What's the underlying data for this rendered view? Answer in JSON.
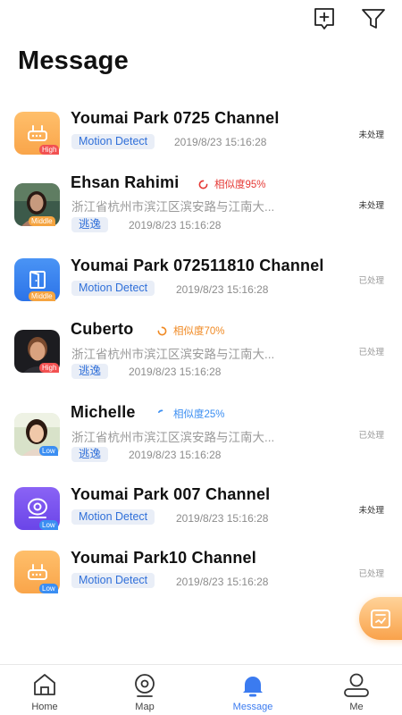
{
  "header": {
    "title": "Message",
    "add_icon": "add-box-icon",
    "filter_icon": "filter-icon"
  },
  "messages": [
    {
      "kind": "device",
      "icon": "router-icon",
      "color": "#f9a54a",
      "level": "High",
      "title": "Youmai Park 0725 Channel",
      "tag": "Motion Detect",
      "time": "2019/8/23  15:16:28",
      "status": "未处理"
    },
    {
      "kind": "person",
      "icon": "person-photo",
      "level": "Middle",
      "title": "Ehsan Rahimi",
      "similarity": "相似度95%",
      "similarity_color": "#e53935",
      "address": "浙江省杭州市滨江区滨安路与江南大...",
      "tag": "逃逸",
      "time": "2019/8/23  15:16:28",
      "status": "未处理"
    },
    {
      "kind": "device",
      "icon": "door-icon",
      "color": "#2c73e8",
      "level": "Middle",
      "title": "Youmai Park 072511810 Channel",
      "tag": "Motion Detect",
      "time": "2019/8/23  15:16:28",
      "status": "已处理"
    },
    {
      "kind": "person",
      "icon": "person-photo",
      "level": "High",
      "title": "Cuberto",
      "similarity": "相似度70%",
      "similarity_color": "#f08a24",
      "address": "浙江省杭州市滨江区滨安路与江南大...",
      "tag": "逃逸",
      "time": "2019/8/23  15:16:28",
      "status": "已处理"
    },
    {
      "kind": "person",
      "icon": "person-photo",
      "level": "Low",
      "title": "Michelle",
      "similarity": "相似度25%",
      "similarity_color": "#3b8ef2",
      "address": "浙江省杭州市滨江区滨安路与江南大...",
      "tag": "逃逸",
      "time": "2019/8/23  15:16:28",
      "status": "已处理"
    },
    {
      "kind": "device",
      "icon": "camera-icon",
      "color": "#6a45e8",
      "level": "Low",
      "title": "Youmai Park 007 Channel",
      "tag": "Motion Detect",
      "time": "2019/8/23  15:16:28",
      "status": "未处理"
    },
    {
      "kind": "device",
      "icon": "router-icon",
      "color": "#f9a54a",
      "level": "Low",
      "title": "Youmai Park10 Channel",
      "tag": "Motion Detect",
      "time": "2019/8/23  15:16:28",
      "status": "已处理"
    }
  ],
  "fab": {
    "icon": "task-check-icon",
    "color": "#f9a24b"
  },
  "tabbar": {
    "active_color": "#3b7bf0",
    "items": [
      {
        "label": "Home",
        "icon": "home-icon"
      },
      {
        "label": "Map",
        "icon": "map-pin-icon"
      },
      {
        "label": "Message",
        "icon": "bell-icon",
        "active": true
      },
      {
        "label": "Me",
        "icon": "user-icon"
      }
    ]
  }
}
